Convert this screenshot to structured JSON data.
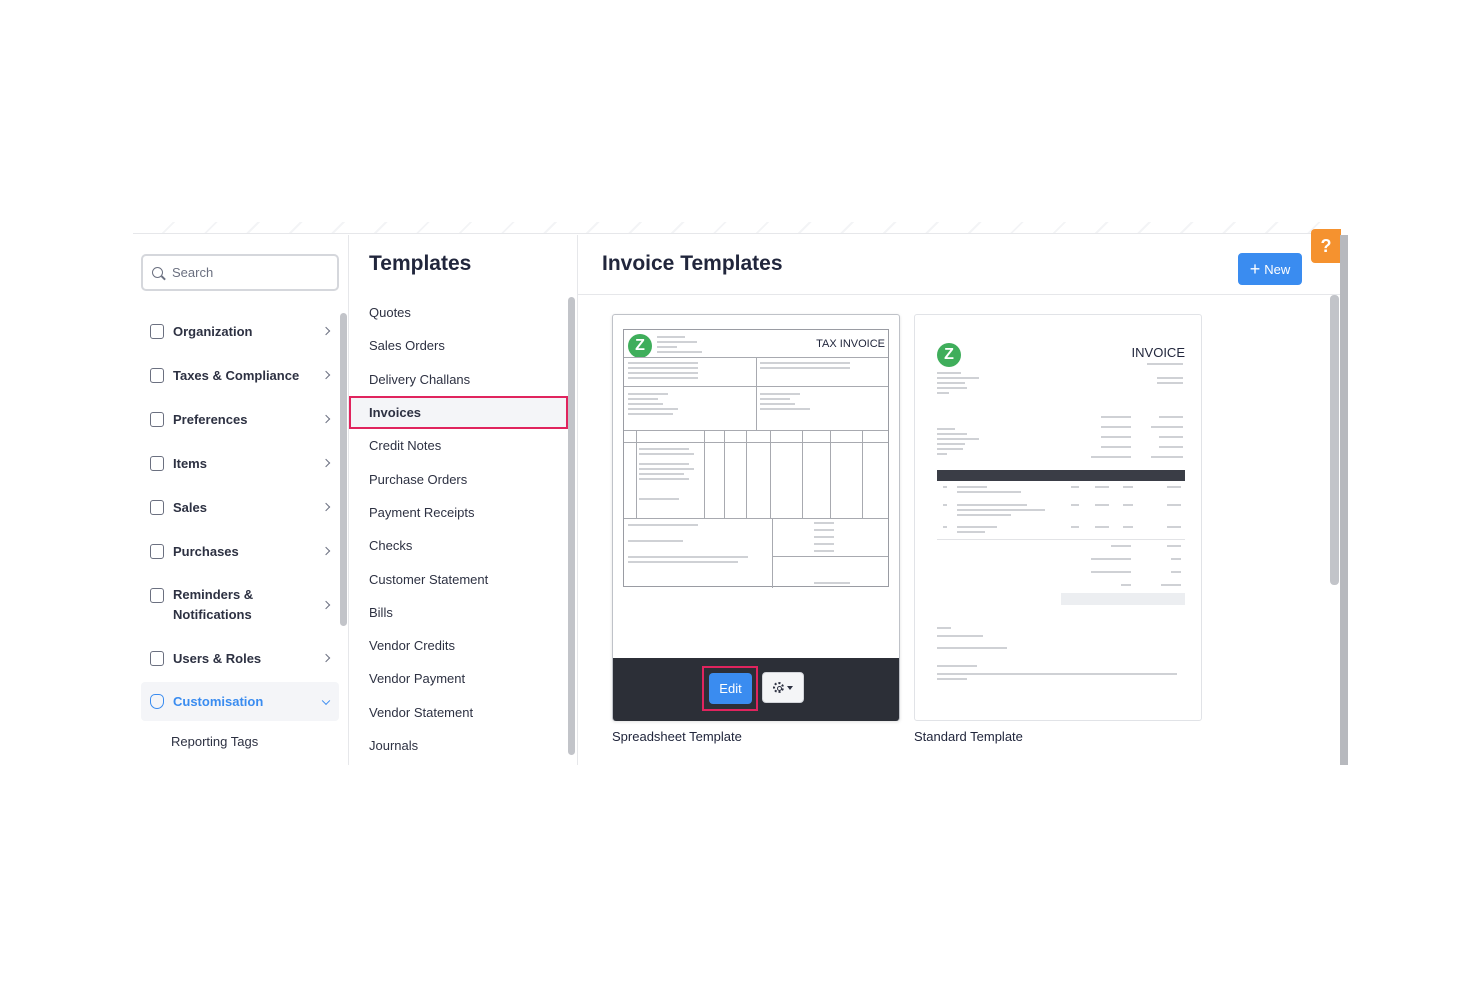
{
  "search": {
    "placeholder": "Search"
  },
  "sidebar": {
    "items": [
      {
        "label": "Organization"
      },
      {
        "label": "Taxes & Compliance"
      },
      {
        "label": "Preferences"
      },
      {
        "label": "Items"
      },
      {
        "label": "Sales"
      },
      {
        "label": "Purchases"
      },
      {
        "label_line1": "Reminders &",
        "label_line2": "Notifications"
      },
      {
        "label": "Users & Roles"
      },
      {
        "label": "Customisation"
      }
    ],
    "sub_items": [
      {
        "label": "Reporting Tags"
      }
    ]
  },
  "templates_panel": {
    "title": "Templates",
    "items": [
      {
        "label": "Quotes"
      },
      {
        "label": "Sales Orders"
      },
      {
        "label": "Delivery Challans"
      },
      {
        "label": "Invoices"
      },
      {
        "label": "Credit Notes"
      },
      {
        "label": "Purchase Orders"
      },
      {
        "label": "Payment Receipts"
      },
      {
        "label": "Checks"
      },
      {
        "label": "Customer Statement"
      },
      {
        "label": "Bills"
      },
      {
        "label": "Vendor Credits"
      },
      {
        "label": "Vendor Payment"
      },
      {
        "label": "Vendor Statement"
      },
      {
        "label": "Journals"
      }
    ],
    "selected": "Invoices"
  },
  "main": {
    "title": "Invoice Templates",
    "new_label": "New",
    "cards": [
      {
        "label": "Spreadsheet Template",
        "heading": "TAX INVOICE",
        "logo": "Z",
        "edit_label": "Edit"
      },
      {
        "label": "Standard Template",
        "heading": "INVOICE",
        "logo": "Z"
      }
    ]
  },
  "help": {
    "label": "?"
  },
  "colors": {
    "accent": "#3a8cf0",
    "highlight": "#e0245e",
    "help": "#f5922f",
    "logo": "#3fae5b"
  }
}
